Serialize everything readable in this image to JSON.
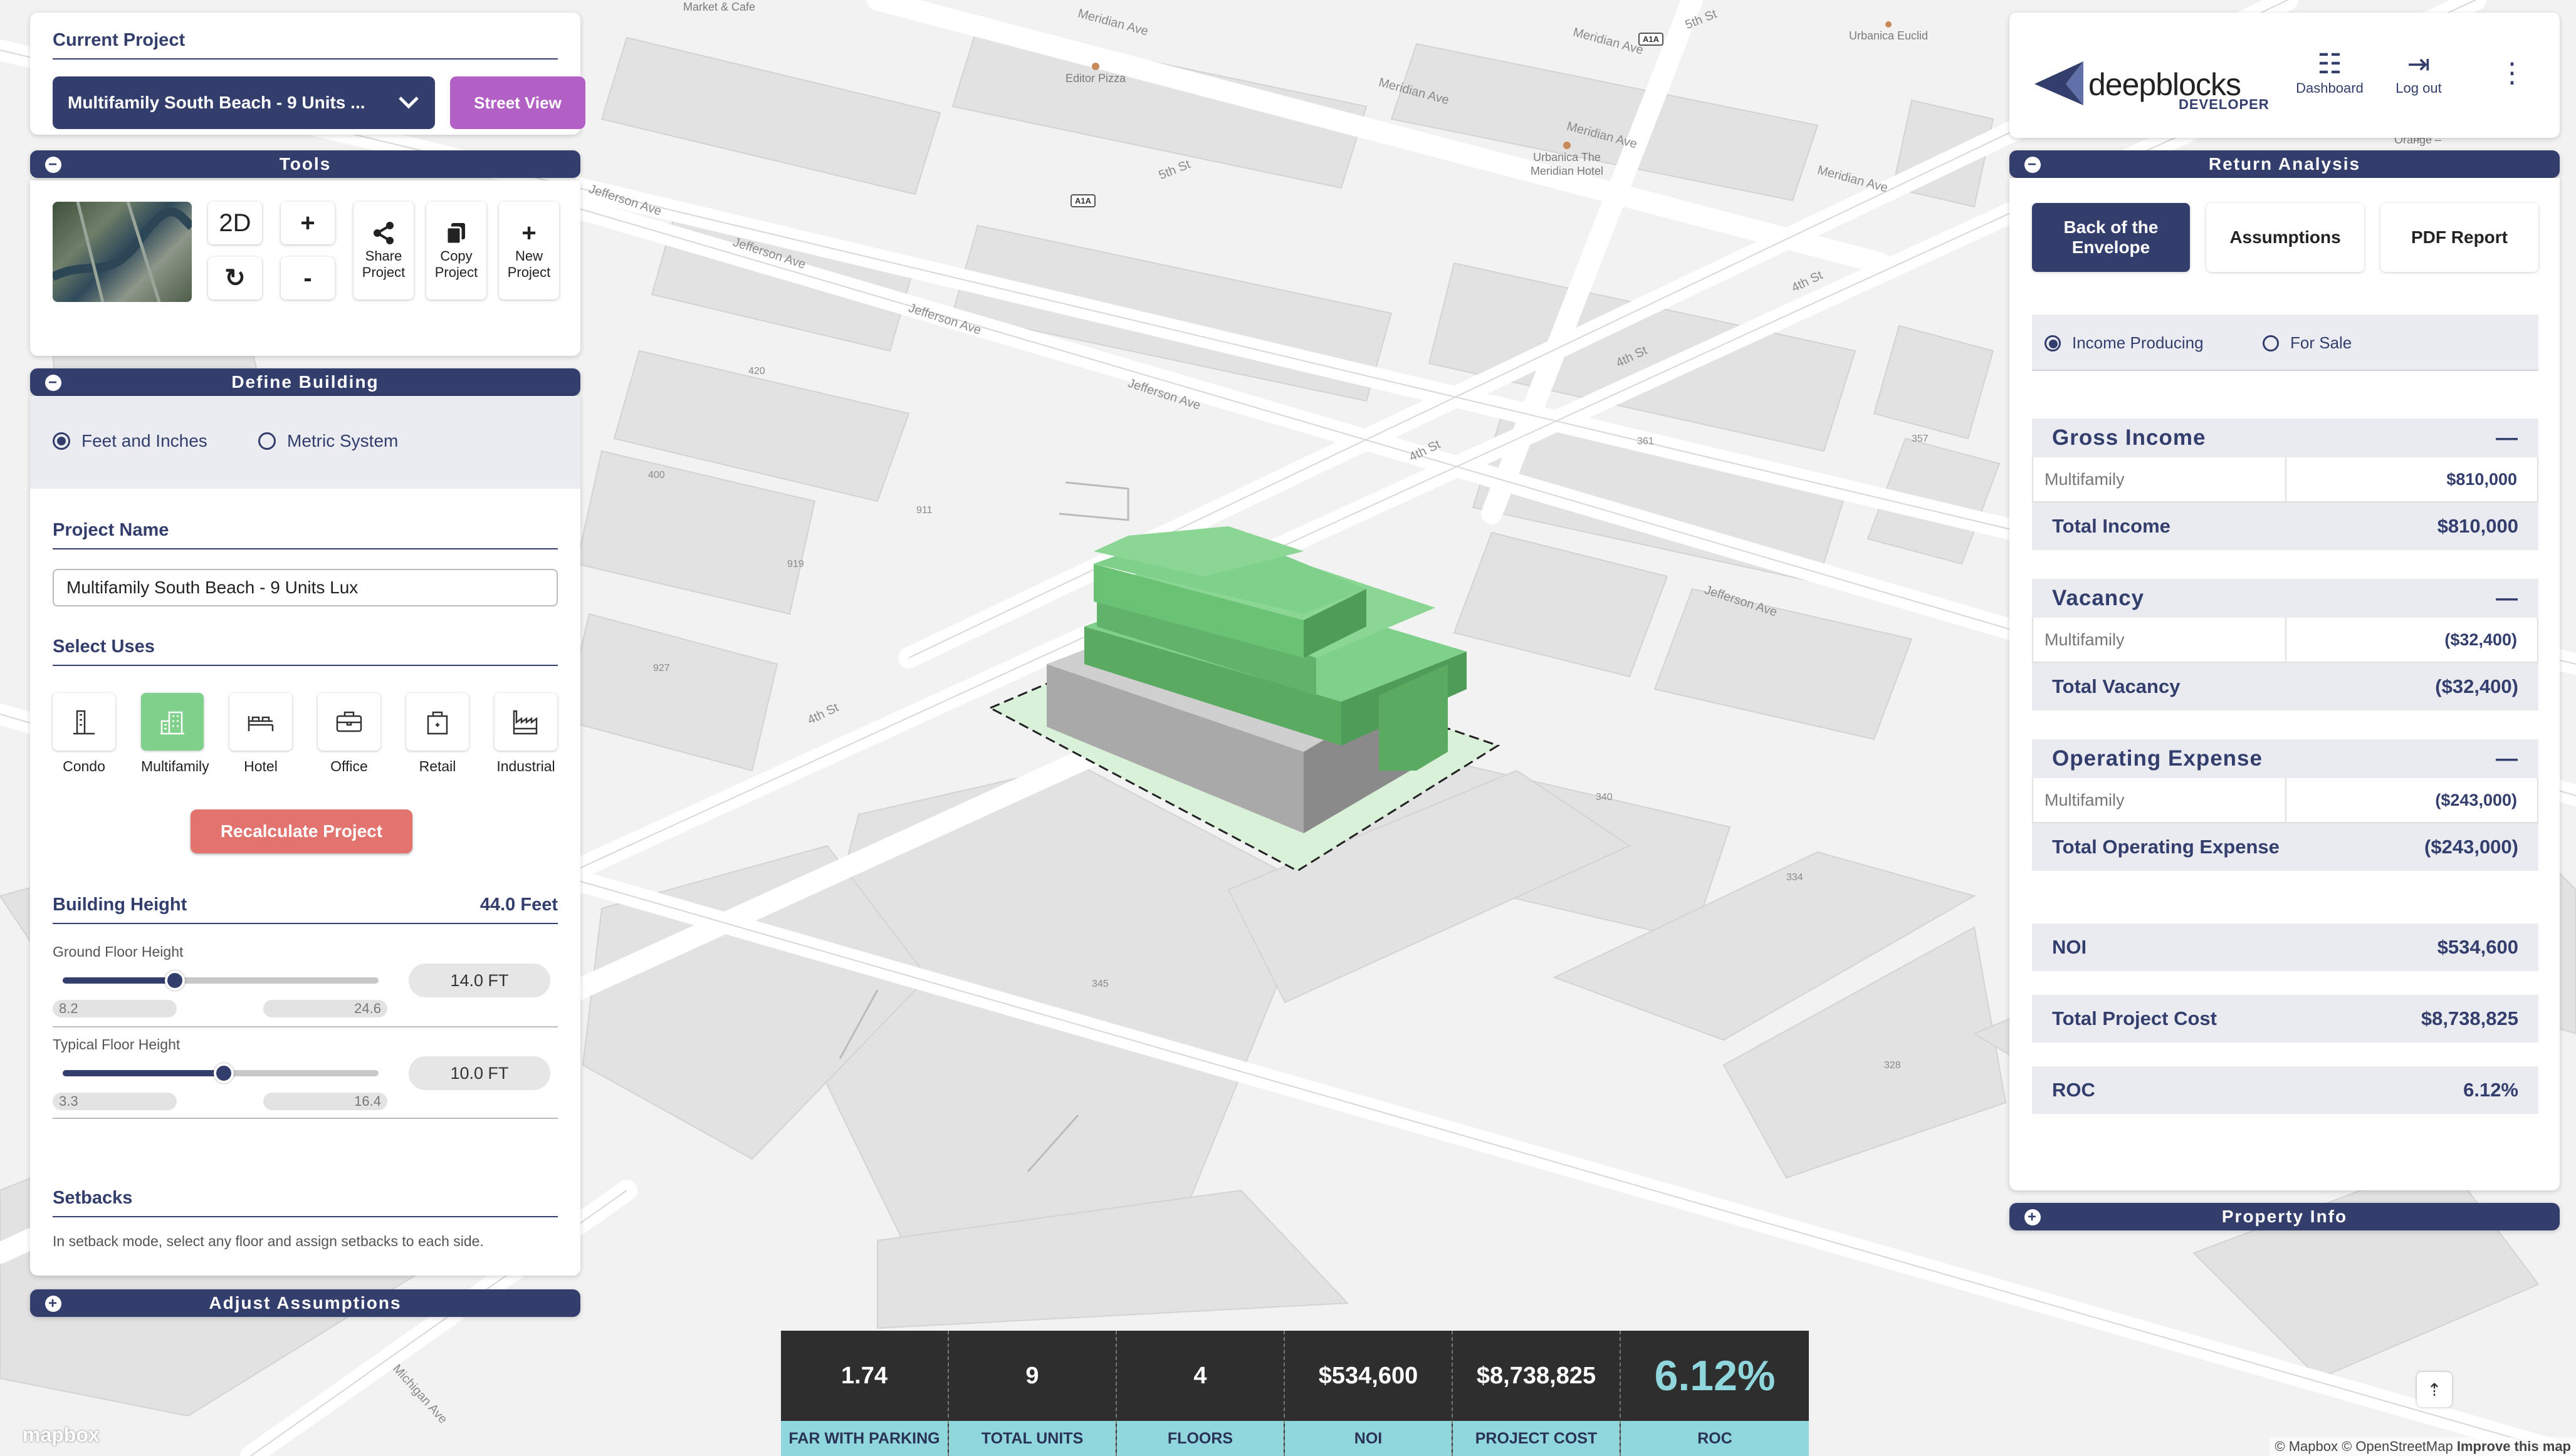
{
  "map": {
    "streets": [
      "Jefferson Ave",
      "Jefferson Ave",
      "Jefferson Ave",
      "Jefferson Ave",
      "Jefferson Ave",
      "4th St",
      "4th St",
      "4th St",
      "4th St",
      "5th St",
      "5th St",
      "5th St",
      "Meridian Ave",
      "Meridian Ave",
      "Meridian Ave",
      "Meridian Ave",
      "Meridian Ave",
      "Michigan Ave"
    ],
    "pois": {
      "editor_pizza": "Editor Pizza",
      "urbanica_meridian": "Urbanica The Meridian Hotel",
      "urbanica_euclid": "Urbanica Euclid",
      "market_cafe": "Market & Cafe",
      "orange": "Orange –"
    },
    "shields": [
      "A1A",
      "A1A"
    ],
    "parcel_numbers": [
      "911",
      "919",
      "927",
      "345",
      "340",
      "334",
      "361",
      "357",
      "328",
      "420",
      "400"
    ],
    "logo": "mapbox",
    "attribution": "© Mapbox © OpenStreetMap",
    "improve_link": "Improve this map"
  },
  "current_project": {
    "label": "Current Project",
    "selected": "Multifamily South Beach - 9 Units ...",
    "street_view": "Street View"
  },
  "tools": {
    "header": "Tools",
    "mode": "2D",
    "zoom_in": "+",
    "zoom_out": "-",
    "share": "Share Project",
    "copy": "Copy Project",
    "new": "New Project"
  },
  "define_building": {
    "header": "Define Building",
    "units": [
      "Feet and Inches",
      "Metric System"
    ],
    "project_name_label": "Project Name",
    "project_name_value": "Multifamily South Beach - 9 Units Lux",
    "select_uses_label": "Select Uses",
    "uses": [
      "Condo",
      "Multifamily",
      "Hotel",
      "Office",
      "Retail",
      "Industrial"
    ],
    "selected_use": "Multifamily",
    "recalculate": "Recalculate Project",
    "building_height_label": "Building Height",
    "building_height_value": "44.0 Feet",
    "ground_floor": {
      "label": "Ground Floor Height",
      "min": "8.2",
      "max": "24.6",
      "value": "14.0 FT",
      "level": 0.355
    },
    "typical_floor": {
      "label": "Typical Floor Height",
      "min": "3.3",
      "max": "16.4",
      "value": "10.0 FT",
      "level": 0.51
    },
    "setbacks_label": "Setbacks",
    "setbacks_text": "In setback mode, select any floor and assign setbacks to each side."
  },
  "adjust_assumptions": "Adjust Assumptions",
  "brand": {
    "name": "deepblocks",
    "sub": "DEVELOPER",
    "dashboard": "Dashboard",
    "logout": "Log out"
  },
  "return_analysis": {
    "header": "Return Analysis",
    "tabs": [
      "Back of the Envelope",
      "Assumptions",
      "PDF Report"
    ],
    "modes": [
      "Income Producing",
      "For Sale"
    ],
    "gross_income": {
      "title": "Gross Income",
      "row_label": "Multifamily",
      "row_value": "$810,000",
      "total_label": "Total Income",
      "total_value": "$810,000"
    },
    "vacancy": {
      "title": "Vacancy",
      "row_label": "Multifamily",
      "row_value": "($32,400)",
      "total_label": "Total Vacancy",
      "total_value": "($32,400)"
    },
    "operating_expense": {
      "title": "Operating Expense",
      "row_label": "Multifamily",
      "row_value": "($243,000)",
      "total_label": "Total Operating Expense",
      "total_value": "($243,000)"
    },
    "noi": {
      "label": "NOI",
      "value": "$534,600"
    },
    "total_project_cost": {
      "label": "Total Project Cost",
      "value": "$8,738,825"
    },
    "roc": {
      "label": "ROC",
      "value": "6.12%"
    }
  },
  "property_info": "Property Info",
  "stats": [
    {
      "value": "1.74",
      "label": "FAR WITH PARKING"
    },
    {
      "value": "9",
      "label": "TOTAL UNITS"
    },
    {
      "value": "4",
      "label": "FLOORS"
    },
    {
      "value": "$534,600",
      "label": "NOI"
    },
    {
      "value": "$8,738,825",
      "label": "PROJECT COST"
    },
    {
      "value": "6.12%",
      "label": "ROC"
    }
  ],
  "colors": {
    "navy": "#333e6c",
    "green": "#7fd08a",
    "teal": "#8fd7dd",
    "street_view": "#b25fc6",
    "recalc": "#e3736e"
  }
}
